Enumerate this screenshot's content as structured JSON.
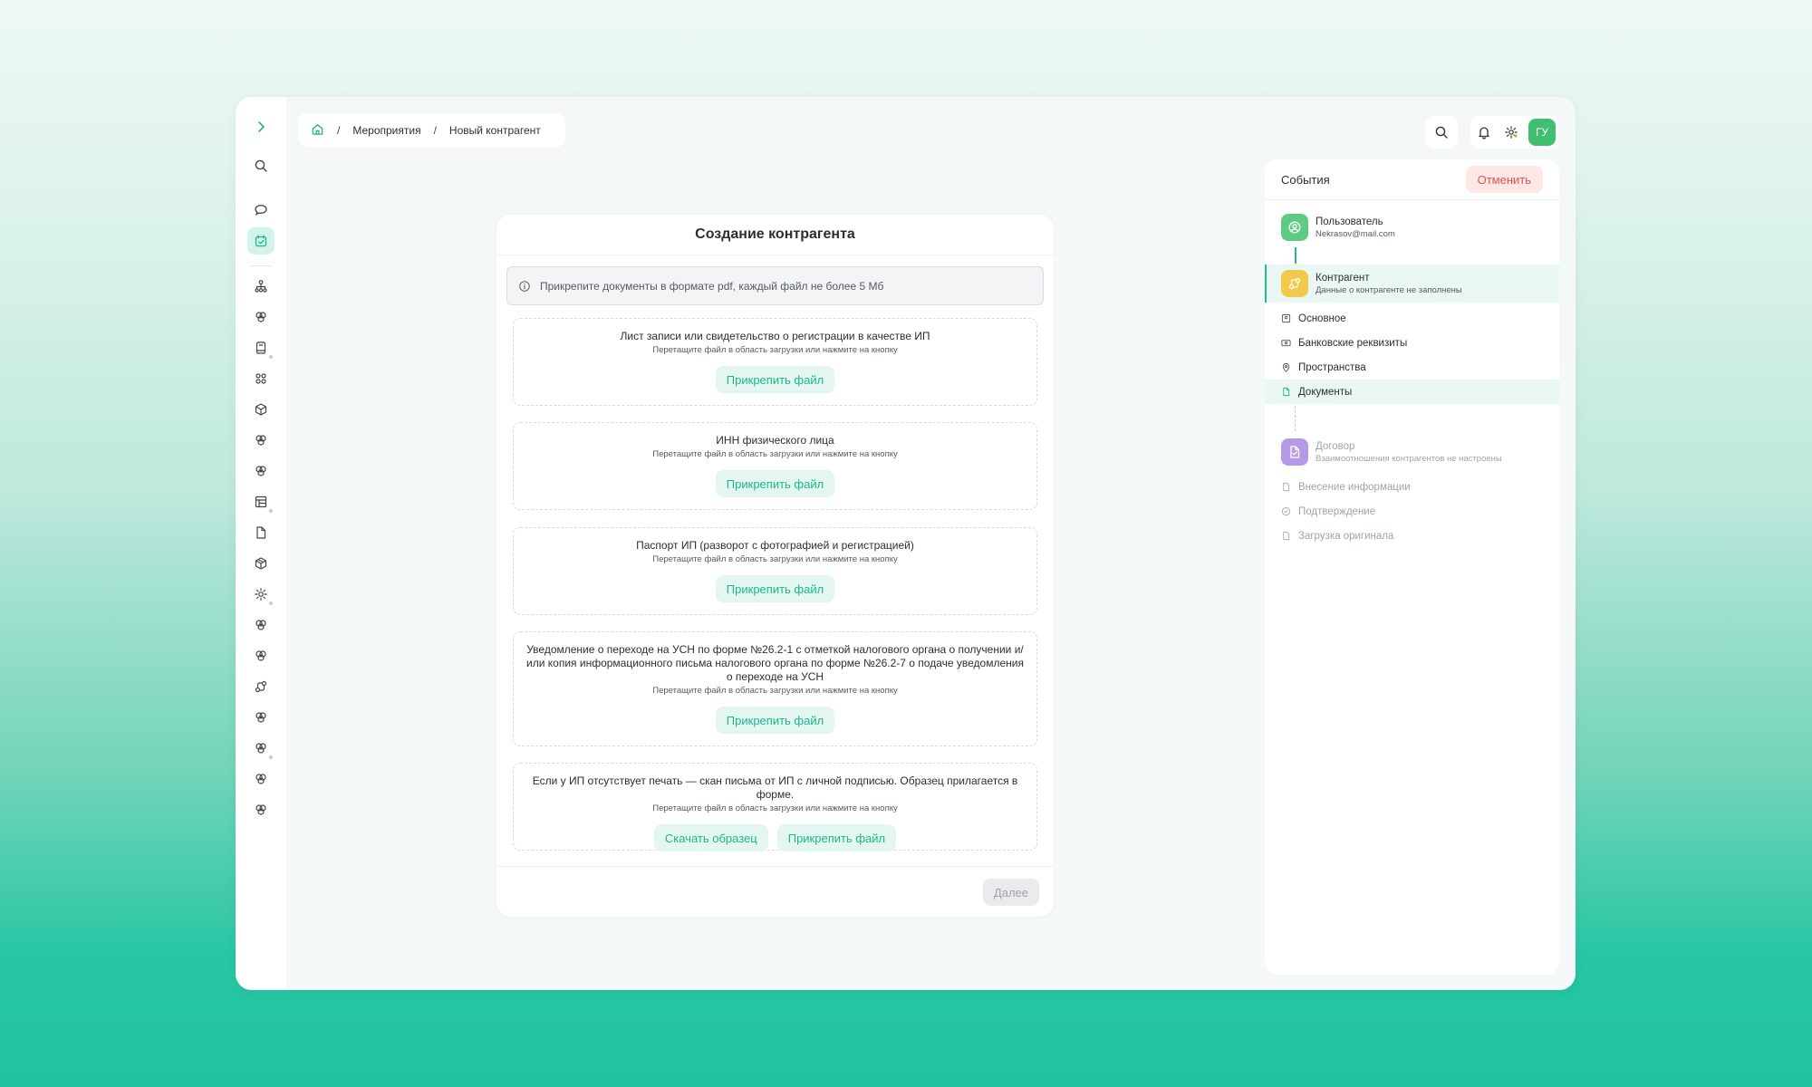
{
  "breadcrumb": {
    "items": [
      "Мероприятия",
      "Новый контрагент"
    ],
    "separator": "/"
  },
  "header": {
    "avatar_initials": "ГУ"
  },
  "card": {
    "title": "Создание контрагента",
    "info": "Прикрепите документы в формате pdf, каждый файл не более 5 Мб",
    "hint": "Перетащите файл в область загрузки или нажмите на кнопку",
    "attach_label": "Прикрепить файл",
    "download_label": "Скачать образец",
    "next_label": "Далее",
    "uploads": [
      {
        "title": "Лист записи или свидетельство о регистрации в качестве ИП"
      },
      {
        "title": "ИНН физического лица"
      },
      {
        "title": "Паспорт ИП (разворот с фотографией и регистрацией)"
      },
      {
        "title": "Уведомление о переходе на УСН по форме №26.2-1 с отметкой налогового органа о получении и/или копия информационного письма налогового органа по форме №26.2-7 о подаче уведомления о переходе на УСН"
      },
      {
        "title": "Если у ИП отсутствует печать — скан письма от ИП с личной подписью. Образец прилагается в форме."
      }
    ]
  },
  "events": {
    "title": "События",
    "cancel_label": "Отменить",
    "user": {
      "name": "Пользователь",
      "sub": "Nekrasov@mail.com"
    },
    "counterparty": {
      "name": "Контрагент",
      "sub": "Данные о контрагенте не заполнены"
    },
    "counterparty_items": [
      "Основное",
      "Банковские реквизиты",
      "Пространства",
      "Документы"
    ],
    "contract": {
      "name": "Договор",
      "sub": "Взаимоотношения контрагентов не настроены"
    },
    "contract_items": [
      "Внесение информации",
      "Подтверждение",
      "Загрузка оригинала"
    ]
  },
  "colors": {
    "accent": "#1fb58f",
    "cancel": "#ea4f4a",
    "avatar": "#3fbf6f"
  }
}
